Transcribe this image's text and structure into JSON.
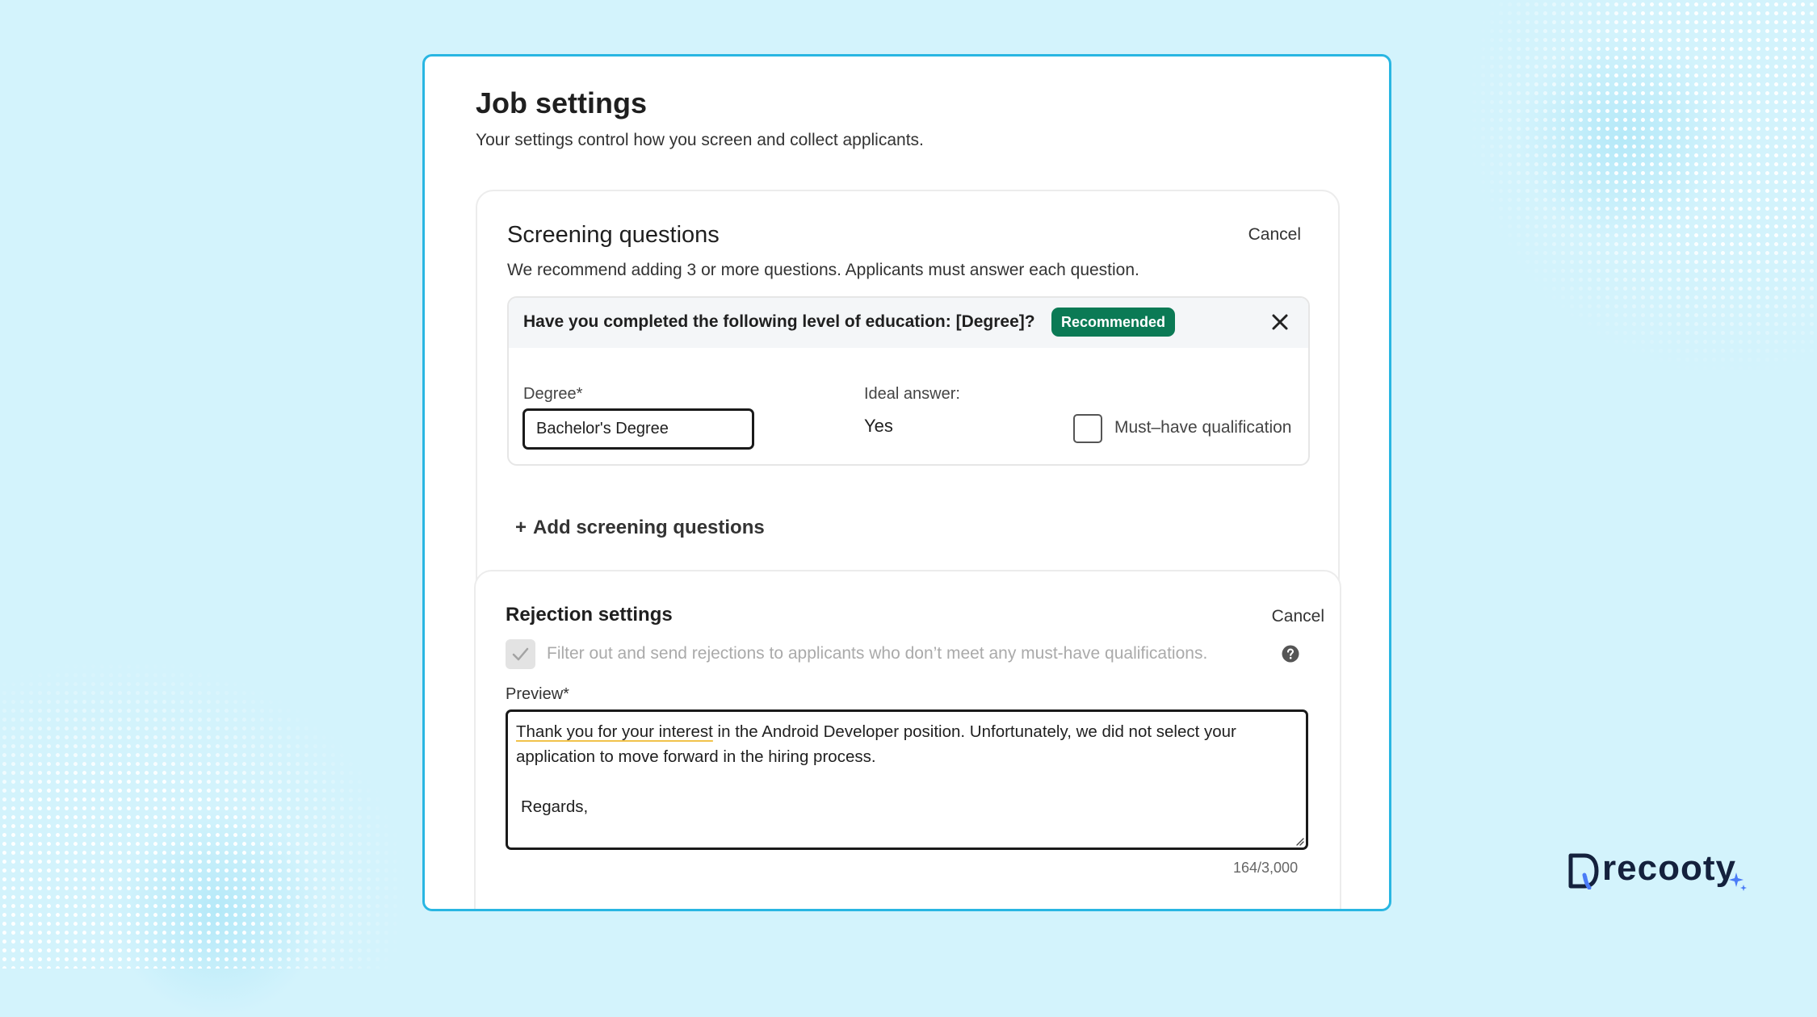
{
  "page": {
    "title": "Job settings",
    "subtitle": "Your settings control how you screen and collect applicants."
  },
  "screening": {
    "title": "Screening questions",
    "description": "We recommend adding 3 or more questions. Applicants must answer each question.",
    "cancel_label": "Cancel",
    "question": {
      "text": "Have you completed the following level of education: [Degree]?",
      "badge": "Recommended",
      "degree_label": "Degree*",
      "degree_value": "Bachelor's Degree",
      "ideal_label": "Ideal answer:",
      "ideal_value": "Yes",
      "must_have_label": "Must–have qualification",
      "must_have_checked": false
    },
    "add_label": "Add screening questions"
  },
  "rejection": {
    "title": "Rejection settings",
    "cancel_label": "Cancel",
    "filter_label": "Filter out and send rejections to applicants who don’t meet any must-have qualifications.",
    "filter_checked": true,
    "preview_label": "Preview*",
    "preview_underlined": "Thank you for your interest",
    "preview_line1_rest": " in the Android Developer position. Unfortunately, we did not select your application to move forward in the hiring process.",
    "preview_regards": "Regards,",
    "char_count": "164/3,000"
  },
  "brand": {
    "logo_text": "recooty",
    "accent": "#29b6e2",
    "badge_color": "#0b7a55",
    "background": "#d3f3fc"
  }
}
